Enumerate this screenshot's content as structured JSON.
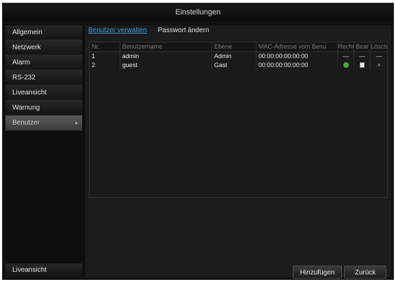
{
  "window": {
    "title": "Einstellungen"
  },
  "sidebar": {
    "items": [
      {
        "label": "Allgemein"
      },
      {
        "label": "Netzwerk"
      },
      {
        "label": "Alarm"
      },
      {
        "label": "RS-232"
      },
      {
        "label": "Liveansicht"
      },
      {
        "label": "Warnung"
      },
      {
        "label": "Benutzer",
        "active": true
      }
    ],
    "bottom_label": "Liveansicht"
  },
  "tabs": [
    {
      "label": "Benutzer verwalten",
      "active": true
    },
    {
      "label": "Passwort ändern"
    }
  ],
  "table": {
    "headers": [
      "Nr.",
      "Benutzername",
      "Ebene",
      "MAC-Adresse vom Benu",
      "Recht",
      "Bear",
      "Lösch"
    ],
    "rows": [
      {
        "nr": "1",
        "name": "admin",
        "level": "Admin",
        "mac": "00:00:00:00:00:00",
        "right": "—",
        "edit": "—",
        "delete": "—"
      },
      {
        "nr": "2",
        "name": "guest",
        "level": "Gast",
        "mac": "00:00:00:00:00:00",
        "right_icon": "check-circle-icon",
        "edit_icon": "edit-icon",
        "delete_icon": "delete-icon"
      }
    ]
  },
  "buttons": {
    "add": "Hinzufügen",
    "back": "Zurück"
  },
  "colors": {
    "accent": "#3f9fe0",
    "ok": "#3fb04a"
  }
}
